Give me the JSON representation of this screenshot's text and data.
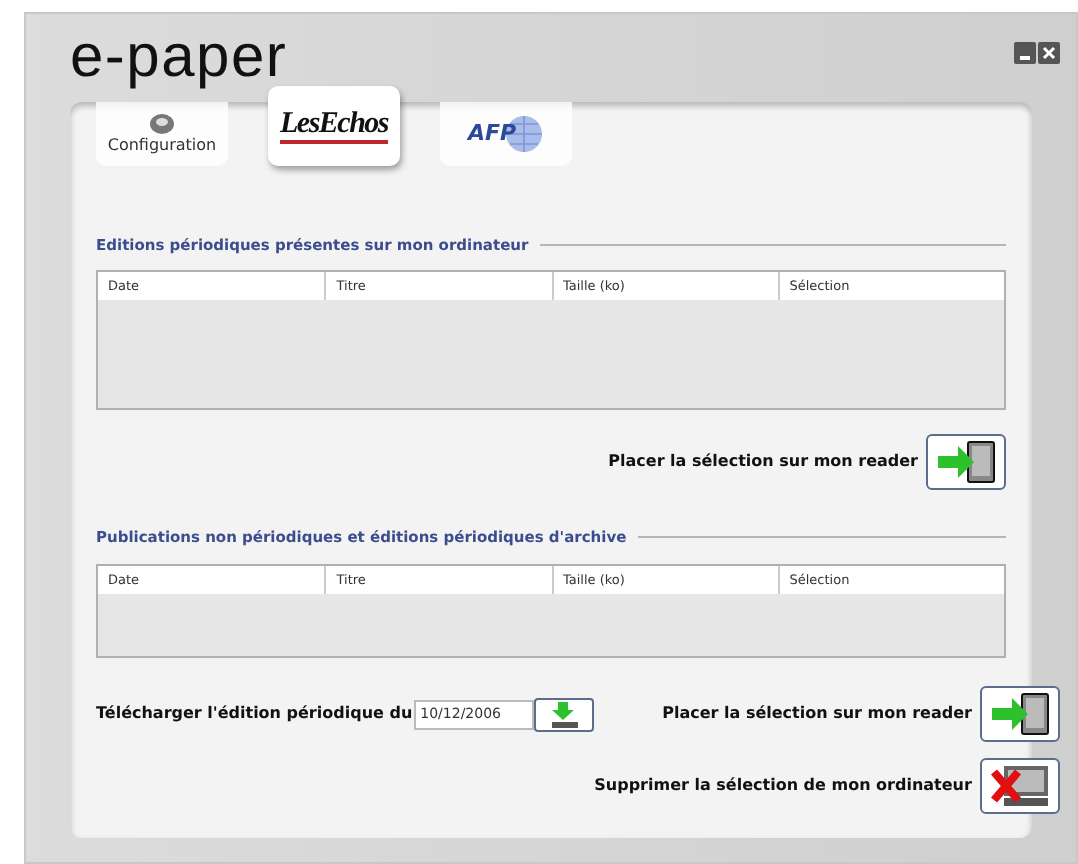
{
  "window": {
    "title": "e-paper"
  },
  "tabs": [
    {
      "kind": "config",
      "label": "Configuration",
      "selected": false
    },
    {
      "kind": "lesechos",
      "label": "LesEchos",
      "selected": true
    },
    {
      "kind": "afp",
      "label": "AFP",
      "selected": false
    }
  ],
  "sections": [
    {
      "heading": "Editions périodiques présentes sur mon ordinateur",
      "columns": [
        "Date",
        "Titre",
        "Taille (ko)",
        "Sélection"
      ]
    },
    {
      "heading": "Publications non périodiques et éditions périodiques d'archive",
      "columns": [
        "Date",
        "Titre",
        "Taille (ko)",
        "Sélection"
      ]
    }
  ],
  "place_button_1": {
    "label": "Placer la sélection sur mon reader"
  },
  "download": {
    "label": "Télécharger l'édition périodique du",
    "date": "10/12/2006"
  },
  "actions": [
    {
      "kind": "reader",
      "label": "Placer la sélection sur mon reader"
    },
    {
      "kind": "delete",
      "label": "Supprimer la sélection de mon ordinateur"
    }
  ]
}
